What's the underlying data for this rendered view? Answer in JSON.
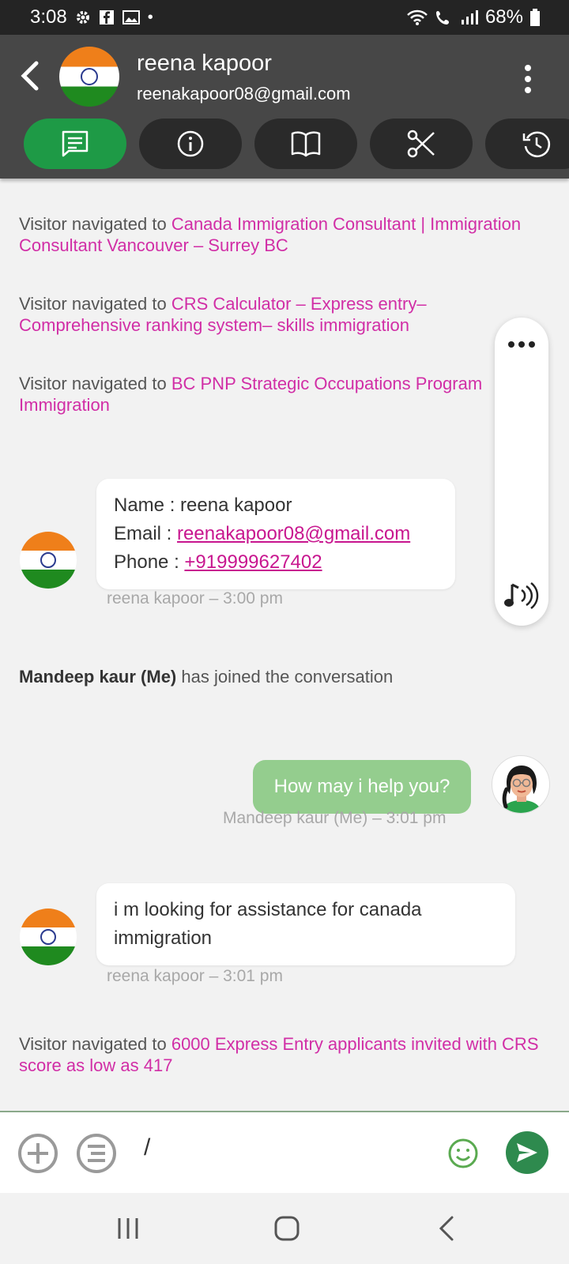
{
  "status_bar": {
    "time": "3:08",
    "battery": "68%"
  },
  "header": {
    "contact_name": "reena kapoor",
    "contact_email": "reenakapoor08@gmail.com",
    "tabs": [
      {
        "icon": "chat-icon",
        "active": true
      },
      {
        "icon": "info-icon",
        "active": false
      },
      {
        "icon": "book-icon",
        "active": false
      },
      {
        "icon": "scissors-icon",
        "active": false
      },
      {
        "icon": "history-icon",
        "active": false
      }
    ]
  },
  "navigations": [
    {
      "prefix": "Visitor navigated to ",
      "link": "Canada Immigration Consultant | Immigration Consultant Vancouver – Surrey BC"
    },
    {
      "prefix": "Visitor navigated to ",
      "link": "CRS Calculator – Express entry– Comprehensive ranking system– skills immigration"
    },
    {
      "prefix": "Visitor navigated to ",
      "link": "BC PNP Strategic Occupations Program Immigration"
    },
    {
      "prefix": "Visitor navigated to ",
      "link": "6000 Express Entry applicants invited with CRS score as low as 417"
    }
  ],
  "info_card": {
    "name_label": "Name : ",
    "name_value": "reena kapoor",
    "email_label": "Email : ",
    "email_value": "reenakapoor08@gmail.com",
    "phone_label": "Phone : ",
    "phone_value": "+919999627402",
    "meta": "reena kapoor – 3:00 pm"
  },
  "joined": {
    "agent": "Mandeep kaur (Me)",
    "text": " has joined the conversation"
  },
  "agent_message": {
    "text": "How may i help you?",
    "meta": "Mandeep kaur (Me) – 3:01 pm"
  },
  "visitor_message": {
    "text": "i m looking for assistance for canada immigration",
    "meta": "reena kapoor – 3:01 pm"
  },
  "composer": {
    "value": "/"
  },
  "colors": {
    "accent_green": "#1e9a46",
    "link_pink": "#d12ea6",
    "agent_bubble": "#94cd8e",
    "header_bg": "#474747"
  }
}
